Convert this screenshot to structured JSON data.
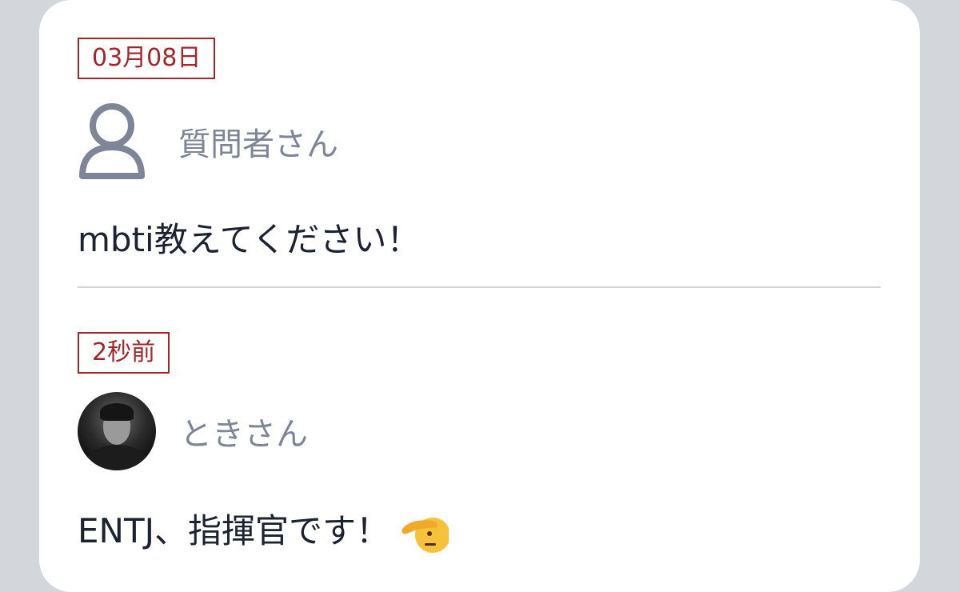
{
  "question": {
    "date": "03月08日",
    "author": "質問者さん",
    "author_icon": "user-outline-icon",
    "text": "mbti教えてください！"
  },
  "answer": {
    "date": "2秒前",
    "author": "ときさん",
    "author_icon": "profile-photo",
    "text": "ENTJ、指揮官です！",
    "emoji": "saluting-face-emoji"
  },
  "colors": {
    "tag": "#a3262a",
    "name": "#7d8597",
    "text": "#1c2230",
    "background": "#d3d6db",
    "card": "#ffffff"
  }
}
